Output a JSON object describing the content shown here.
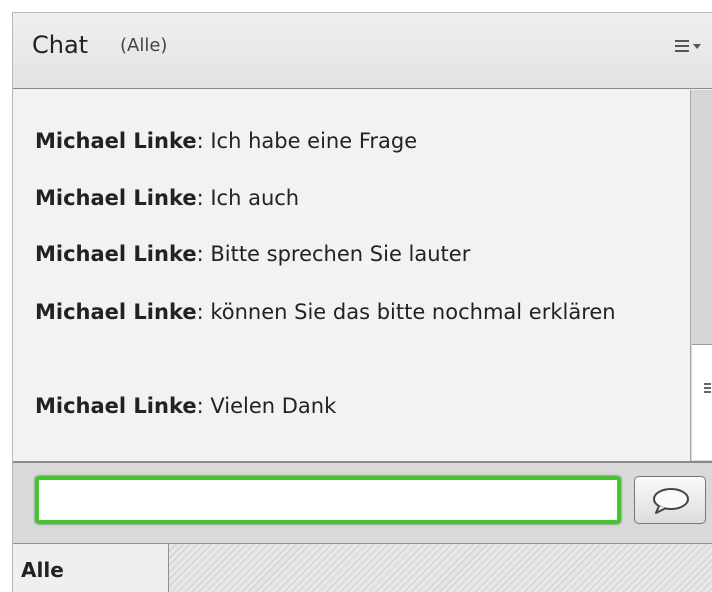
{
  "header": {
    "title": "Chat",
    "audience": "(Alle)",
    "menu_icon": "hamburger-menu-icon"
  },
  "messages": [
    {
      "sender": "Michael Linke",
      "text": " Ich habe eine Frage"
    },
    {
      "sender": "Michael Linke",
      "text": " Ich auch"
    },
    {
      "sender": "Michael Linke",
      "text": " Bitte sprechen Sie lauter"
    },
    {
      "sender": "Michael Linke",
      "text": " können Sie das bitte nochmal erklären"
    },
    {
      "sender": "Michael Linke",
      "text": " Vielen Dank"
    }
  ],
  "input": {
    "value": "",
    "placeholder": "",
    "send_icon": "speech-bubble-icon"
  },
  "tabs": [
    {
      "label": "Alle"
    }
  ],
  "colors": {
    "input_border": "#46c232",
    "panel_bg": "#efefef"
  }
}
